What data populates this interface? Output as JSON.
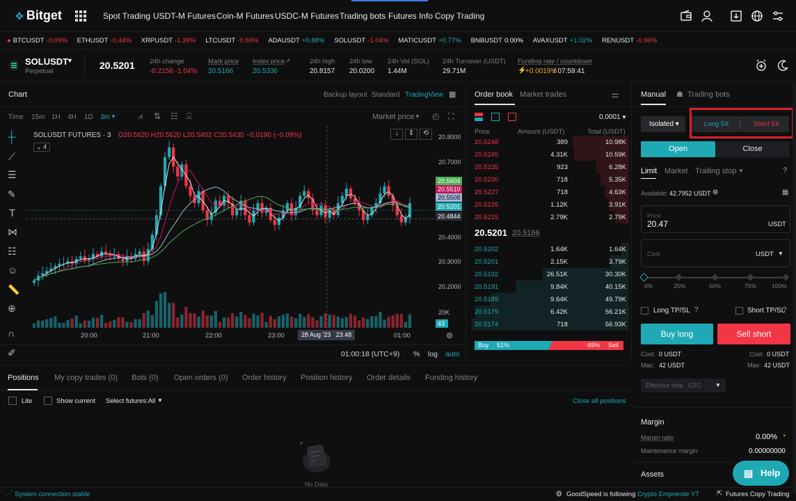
{
  "nav": {
    "logo": "Bitget",
    "items": [
      "Spot Trading",
      "USDT-M Futures",
      "Coin-M Futures",
      "USDC-M Futures",
      "Trading bots",
      "Futures Info",
      "Copy Trading"
    ]
  },
  "ticker": [
    {
      "sym": "BTCUSDT",
      "chg": "-0.09%",
      "dir": "down"
    },
    {
      "sym": "ETHUSDT",
      "chg": "-0.44%",
      "dir": "down"
    },
    {
      "sym": "XRPUSDT",
      "chg": "-1.39%",
      "dir": "down"
    },
    {
      "sym": "LTCUSDT",
      "chg": "-0.50%",
      "dir": "down"
    },
    {
      "sym": "ADAUSDT",
      "chg": "+0.88%",
      "dir": "up"
    },
    {
      "sym": "SOLUSDT",
      "chg": "-1.04%",
      "dir": "down"
    },
    {
      "sym": "MATICUSDT",
      "chg": "+0.77%",
      "dir": "up"
    },
    {
      "sym": "BNBUSDT",
      "chg": "0.00%",
      "dir": "flat"
    },
    {
      "sym": "AVAXUSDT",
      "chg": "+1.02%",
      "dir": "up"
    },
    {
      "sym": "RENUSDT",
      "chg": "-0.96%",
      "dir": "down"
    }
  ],
  "symbol": {
    "name": "SOLUSDT",
    "type": "Perpetual",
    "last_price": "20.5201",
    "change_label": "24h change",
    "change_value": "-0.2156 -1.04%",
    "mark_label": "Mark price",
    "mark_value": "20.5166",
    "index_label": "Index price",
    "index_value": "20.5336",
    "high_label": "24h high",
    "high_value": "20.8157",
    "low_label": "24h low",
    "low_value": "20.0200",
    "vol_label": "24h Vol (SOL)",
    "vol_value": "1.44M",
    "turnover_label": "24h Turnover (USDT)",
    "turnover_value": "29.71M",
    "funding_label": "Funding rate / countdown",
    "funding_rate": "+0.0019%",
    "funding_countdown": "/ 07:59:41"
  },
  "chart": {
    "title": "Chart",
    "layout_options": [
      "Backup layout",
      "Standard",
      "TradingView"
    ],
    "intervals": [
      "Time",
      "15m",
      "1H",
      "4H",
      "1D",
      "3m"
    ],
    "price_type": "Market price",
    "legend_name": "SOLUSDT FUTURES · 3",
    "legend_ohlc": "O20.5620 H20.5620 L20.5402 C20.5430 −0.0190 (−0.09%)",
    "indicator_count": "4",
    "y_ticks": [
      "20.8000",
      "20.7000",
      "20.4000",
      "20.3000",
      "20.2000"
    ],
    "vol_tick": "20K",
    "vol_tag": "43",
    "x_ticks": [
      "20:00",
      "21:00",
      "22:00",
      "23:00",
      "01:00"
    ],
    "crosshair_time": "28 Aug '23   23:48",
    "price_tags": [
      {
        "value": "20.5604",
        "color": "#4caf50"
      },
      {
        "value": "20.5510",
        "color": "#c2185b"
      },
      {
        "value": "20.5508",
        "color": "#9fb7d4"
      },
      {
        "value": "20.5201",
        "color": "#1fa9b5"
      },
      {
        "value": "20.4844",
        "color": "#2a2e39"
      }
    ],
    "clock": "01:00:18 (UTC+9)",
    "scale_opts": [
      "%",
      "log",
      "auto"
    ]
  },
  "chart_data": {
    "type": "candlestick",
    "x": [
      "19:24",
      "20:00",
      "21:00",
      "22:00",
      "23:00",
      "23:48",
      "01:00"
    ],
    "ylim": [
      20.15,
      20.84
    ],
    "candles_close": [
      20.23,
      20.25,
      20.26,
      20.27,
      20.28,
      20.29,
      20.3,
      20.3,
      20.31,
      20.3,
      20.32,
      20.33,
      20.31,
      20.32,
      20.34,
      20.33,
      20.35,
      20.34,
      20.33,
      20.34,
      20.32,
      20.31,
      20.33,
      20.32,
      20.34,
      20.35,
      20.31,
      20.36,
      20.42,
      20.5,
      20.62,
      20.74,
      20.78,
      20.7,
      20.66,
      20.71,
      20.62,
      20.58,
      20.55,
      20.6,
      20.52,
      20.48,
      20.51,
      20.56,
      20.54,
      20.58,
      20.55,
      20.5,
      20.52,
      20.56,
      20.5,
      20.47,
      20.52,
      20.55,
      20.51,
      20.53,
      20.48,
      20.46,
      20.49,
      20.52,
      20.55,
      20.5,
      20.53,
      20.58,
      20.6,
      20.57,
      20.52,
      20.5,
      20.54,
      20.49,
      20.52,
      20.5,
      20.55,
      20.58,
      20.61,
      20.57,
      20.55,
      20.52,
      20.48,
      20.5,
      20.53,
      20.55,
      20.59,
      20.62,
      20.58,
      20.54,
      20.5,
      20.47,
      20.49,
      20.55
    ]
  },
  "orderbook": {
    "tabs": [
      "Order book",
      "Market trades"
    ],
    "precision": "0.0001",
    "headers": [
      "Price",
      "Amount (USDT)",
      "Total (USDT)"
    ],
    "asks": [
      {
        "price": "20.5248",
        "amount": "389",
        "total": "10.98K",
        "depth": 0.36
      },
      {
        "price": "20.5245",
        "amount": "4.31K",
        "total": "10.59K",
        "depth": 0.35
      },
      {
        "price": "20.5235",
        "amount": "923",
        "total": "6.28K",
        "depth": 0.21
      },
      {
        "price": "20.5230",
        "amount": "718",
        "total": "5.35K",
        "depth": 0.18
      },
      {
        "price": "20.5227",
        "amount": "718",
        "total": "4.63K",
        "depth": 0.15
      },
      {
        "price": "20.5225",
        "amount": "1.12K",
        "total": "3.91K",
        "depth": 0.13
      },
      {
        "price": "20.5215",
        "amount": "2.79K",
        "total": "2.79K",
        "depth": 0.09
      }
    ],
    "last": "20.5201",
    "mark": "20.5166",
    "bids": [
      {
        "price": "20.5202",
        "amount": "1.64K",
        "total": "1.64K",
        "depth": 0.05
      },
      {
        "price": "20.5201",
        "amount": "2.15K",
        "total": "3.79K",
        "depth": 0.12
      },
      {
        "price": "20.5192",
        "amount": "26.51K",
        "total": "30.30K",
        "depth": 0.55
      },
      {
        "price": "20.5191",
        "amount": "9.84K",
        "total": "40.15K",
        "depth": 0.72
      },
      {
        "price": "20.5189",
        "amount": "9.64K",
        "total": "49.79K",
        "depth": 0.88
      },
      {
        "price": "20.5179",
        "amount": "6.42K",
        "total": "56.21K",
        "depth": 0.98
      },
      {
        "price": "20.5174",
        "amount": "718",
        "total": "56.93K",
        "depth": 1.0
      }
    ],
    "buy_label": "Buy",
    "buy_pct": "51%",
    "sell_pct": "49%",
    "sell_label": "Sell",
    "buy_ratio": 0.51
  },
  "trade": {
    "tabs": [
      "Manual",
      "Trading bots"
    ],
    "margin_mode": "Isolated",
    "long_lev": "Long 5X",
    "short_lev": "Short 5X",
    "open": "Open",
    "close": "Close",
    "order_types": [
      "Limit",
      "Market",
      "Trailing stop"
    ],
    "available_label": "Available:",
    "available_value": "42.7952 USDT",
    "price_label": "Price",
    "price_value": "20.47",
    "price_unit": "USDT",
    "cost_placeholder": "Cost",
    "cost_unit": "USDT",
    "slider_marks": [
      "0%",
      "25%",
      "50%",
      "75%",
      "100%"
    ],
    "long_tpsl": "Long TP/SL",
    "short_tpsl": "Short TP/SL",
    "buy_long": "Buy long",
    "sell_short": "Sell short",
    "cost_long": "Cost:",
    "cost_long_val": "0 USDT",
    "max_long": "Max:",
    "max_long_val": "42 USDT",
    "cost_short": "Cost:",
    "cost_short_val": "0 USDT",
    "max_short": "Max:",
    "max_short_val": "42 USDT",
    "effective_label": "Effective time",
    "effective_value": "GTC",
    "margin_title": "Margin",
    "margin_ratio_label": "Margin ratio",
    "margin_ratio_value": "0.00%",
    "maint_label": "Maintenance margin",
    "maint_value": "0.00000000",
    "assets_title": "Assets",
    "help": "Help"
  },
  "positions": {
    "tabs": [
      "Positions",
      "My copy trades (0)",
      "Bots (0)",
      "Open orders (0)",
      "Order history",
      "Position history",
      "Order details",
      "Funding history"
    ],
    "lite": "Lite",
    "show_current": "Show current",
    "select_futures": "Select futures:All",
    "close_all": "Close all positions",
    "empty": "No Data"
  },
  "status": {
    "connection": "System connection stable",
    "follow_user": "GoodSpeed",
    "follow_text": "is following",
    "follow_target": "Crypto Emprende YT",
    "copy_trading": "Futures Copy Trading"
  },
  "colors": {
    "accent": "#1fa9b5",
    "down": "#f23645",
    "highlight_box": "#e0202a"
  }
}
